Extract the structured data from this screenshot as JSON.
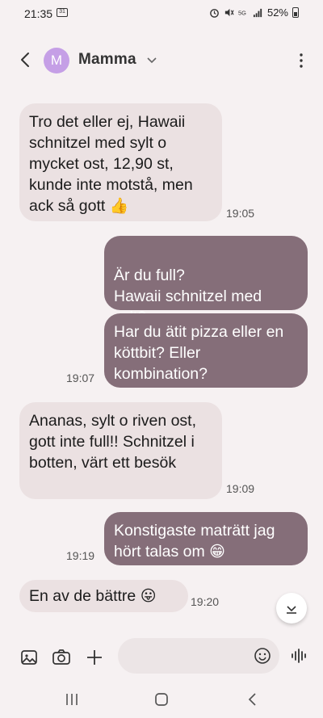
{
  "status_bar": {
    "time": "21:35",
    "battery": "52%"
  },
  "header": {
    "avatar_letter": "M",
    "contact_name": "Mamma"
  },
  "messages": [
    {
      "direction": "in",
      "text": "Tro det eller ej, Hawaii schnitzel med sylt o mycket ost, 12,90 st, kunde inte motstå, men ack så gott",
      "emoji": "👍",
      "time": "19:05"
    },
    {
      "direction": "out",
      "text": "Är du full?\nHawaii schnitzel med sylt?",
      "emoji": "🤣"
    },
    {
      "direction": "out",
      "text": "Har du ätit pizza eller en köttbit? Eller kombination?",
      "time": "19:07"
    },
    {
      "direction": "in",
      "text": "Ananas, sylt o riven ost, gott inte full!! Schnitzel i botten, värt ett besök",
      "time": "19:09"
    },
    {
      "direction": "out",
      "text": "Konstigaste maträtt jag hört talas om",
      "emoji": "😁",
      "time": "19:19"
    },
    {
      "direction": "in",
      "text": "En av de bättre",
      "emoji": "😛",
      "time": "19:20"
    }
  ],
  "input": {
    "placeholder": ""
  },
  "colors": {
    "incoming_bubble": "#ebe1e2",
    "outgoing_bubble": "#856e79",
    "avatar": "#c59fe6",
    "background": "#f6f1f2"
  }
}
